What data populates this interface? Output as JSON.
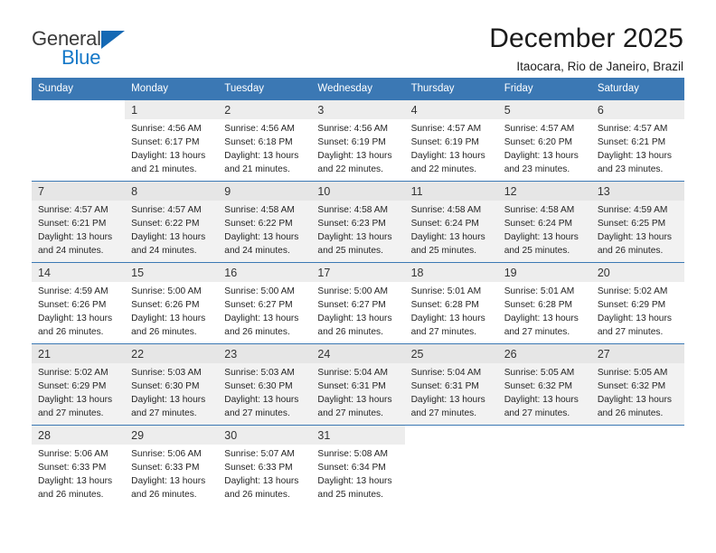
{
  "brand": {
    "name_part1": "General",
    "name_part2": "Blue",
    "color_primary": "#1578c8",
    "color_triangle": "#1569b4"
  },
  "header": {
    "title": "December 2025",
    "subtitle": "Itaocara, Rio de Janeiro, Brazil"
  },
  "calendar": {
    "header_bg": "#3b78b4",
    "weekday_headers": [
      "Sunday",
      "Monday",
      "Tuesday",
      "Wednesday",
      "Thursday",
      "Friday",
      "Saturday"
    ],
    "labels": {
      "sunrise": "Sunrise:",
      "sunset": "Sunset:",
      "daylight": "Daylight:"
    },
    "weeks": [
      [
        {
          "day": "",
          "sunrise": "",
          "sunset": "",
          "daylight": "",
          "empty": true
        },
        {
          "day": "1",
          "sunrise": "Sunrise: 4:56 AM",
          "sunset": "Sunset: 6:17 PM",
          "daylight": "Daylight: 13 hours and 21 minutes."
        },
        {
          "day": "2",
          "sunrise": "Sunrise: 4:56 AM",
          "sunset": "Sunset: 6:18 PM",
          "daylight": "Daylight: 13 hours and 21 minutes."
        },
        {
          "day": "3",
          "sunrise": "Sunrise: 4:56 AM",
          "sunset": "Sunset: 6:19 PM",
          "daylight": "Daylight: 13 hours and 22 minutes."
        },
        {
          "day": "4",
          "sunrise": "Sunrise: 4:57 AM",
          "sunset": "Sunset: 6:19 PM",
          "daylight": "Daylight: 13 hours and 22 minutes."
        },
        {
          "day": "5",
          "sunrise": "Sunrise: 4:57 AM",
          "sunset": "Sunset: 6:20 PM",
          "daylight": "Daylight: 13 hours and 23 minutes."
        },
        {
          "day": "6",
          "sunrise": "Sunrise: 4:57 AM",
          "sunset": "Sunset: 6:21 PM",
          "daylight": "Daylight: 13 hours and 23 minutes."
        }
      ],
      [
        {
          "day": "7",
          "sunrise": "Sunrise: 4:57 AM",
          "sunset": "Sunset: 6:21 PM",
          "daylight": "Daylight: 13 hours and 24 minutes."
        },
        {
          "day": "8",
          "sunrise": "Sunrise: 4:57 AM",
          "sunset": "Sunset: 6:22 PM",
          "daylight": "Daylight: 13 hours and 24 minutes."
        },
        {
          "day": "9",
          "sunrise": "Sunrise: 4:58 AM",
          "sunset": "Sunset: 6:22 PM",
          "daylight": "Daylight: 13 hours and 24 minutes."
        },
        {
          "day": "10",
          "sunrise": "Sunrise: 4:58 AM",
          "sunset": "Sunset: 6:23 PM",
          "daylight": "Daylight: 13 hours and 25 minutes."
        },
        {
          "day": "11",
          "sunrise": "Sunrise: 4:58 AM",
          "sunset": "Sunset: 6:24 PM",
          "daylight": "Daylight: 13 hours and 25 minutes."
        },
        {
          "day": "12",
          "sunrise": "Sunrise: 4:58 AM",
          "sunset": "Sunset: 6:24 PM",
          "daylight": "Daylight: 13 hours and 25 minutes."
        },
        {
          "day": "13",
          "sunrise": "Sunrise: 4:59 AM",
          "sunset": "Sunset: 6:25 PM",
          "daylight": "Daylight: 13 hours and 26 minutes."
        }
      ],
      [
        {
          "day": "14",
          "sunrise": "Sunrise: 4:59 AM",
          "sunset": "Sunset: 6:26 PM",
          "daylight": "Daylight: 13 hours and 26 minutes."
        },
        {
          "day": "15",
          "sunrise": "Sunrise: 5:00 AM",
          "sunset": "Sunset: 6:26 PM",
          "daylight": "Daylight: 13 hours and 26 minutes."
        },
        {
          "day": "16",
          "sunrise": "Sunrise: 5:00 AM",
          "sunset": "Sunset: 6:27 PM",
          "daylight": "Daylight: 13 hours and 26 minutes."
        },
        {
          "day": "17",
          "sunrise": "Sunrise: 5:00 AM",
          "sunset": "Sunset: 6:27 PM",
          "daylight": "Daylight: 13 hours and 26 minutes."
        },
        {
          "day": "18",
          "sunrise": "Sunrise: 5:01 AM",
          "sunset": "Sunset: 6:28 PM",
          "daylight": "Daylight: 13 hours and 27 minutes."
        },
        {
          "day": "19",
          "sunrise": "Sunrise: 5:01 AM",
          "sunset": "Sunset: 6:28 PM",
          "daylight": "Daylight: 13 hours and 27 minutes."
        },
        {
          "day": "20",
          "sunrise": "Sunrise: 5:02 AM",
          "sunset": "Sunset: 6:29 PM",
          "daylight": "Daylight: 13 hours and 27 minutes."
        }
      ],
      [
        {
          "day": "21",
          "sunrise": "Sunrise: 5:02 AM",
          "sunset": "Sunset: 6:29 PM",
          "daylight": "Daylight: 13 hours and 27 minutes."
        },
        {
          "day": "22",
          "sunrise": "Sunrise: 5:03 AM",
          "sunset": "Sunset: 6:30 PM",
          "daylight": "Daylight: 13 hours and 27 minutes."
        },
        {
          "day": "23",
          "sunrise": "Sunrise: 5:03 AM",
          "sunset": "Sunset: 6:30 PM",
          "daylight": "Daylight: 13 hours and 27 minutes."
        },
        {
          "day": "24",
          "sunrise": "Sunrise: 5:04 AM",
          "sunset": "Sunset: 6:31 PM",
          "daylight": "Daylight: 13 hours and 27 minutes."
        },
        {
          "day": "25",
          "sunrise": "Sunrise: 5:04 AM",
          "sunset": "Sunset: 6:31 PM",
          "daylight": "Daylight: 13 hours and 27 minutes."
        },
        {
          "day": "26",
          "sunrise": "Sunrise: 5:05 AM",
          "sunset": "Sunset: 6:32 PM",
          "daylight": "Daylight: 13 hours and 27 minutes."
        },
        {
          "day": "27",
          "sunrise": "Sunrise: 5:05 AM",
          "sunset": "Sunset: 6:32 PM",
          "daylight": "Daylight: 13 hours and 26 minutes."
        }
      ],
      [
        {
          "day": "28",
          "sunrise": "Sunrise: 5:06 AM",
          "sunset": "Sunset: 6:33 PM",
          "daylight": "Daylight: 13 hours and 26 minutes."
        },
        {
          "day": "29",
          "sunrise": "Sunrise: 5:06 AM",
          "sunset": "Sunset: 6:33 PM",
          "daylight": "Daylight: 13 hours and 26 minutes."
        },
        {
          "day": "30",
          "sunrise": "Sunrise: 5:07 AM",
          "sunset": "Sunset: 6:33 PM",
          "daylight": "Daylight: 13 hours and 26 minutes."
        },
        {
          "day": "31",
          "sunrise": "Sunrise: 5:08 AM",
          "sunset": "Sunset: 6:34 PM",
          "daylight": "Daylight: 13 hours and 25 minutes."
        },
        {
          "day": "",
          "sunrise": "",
          "sunset": "",
          "daylight": "",
          "empty": true
        },
        {
          "day": "",
          "sunrise": "",
          "sunset": "",
          "daylight": "",
          "empty": true
        },
        {
          "day": "",
          "sunrise": "",
          "sunset": "",
          "daylight": "",
          "empty": true
        }
      ]
    ]
  }
}
